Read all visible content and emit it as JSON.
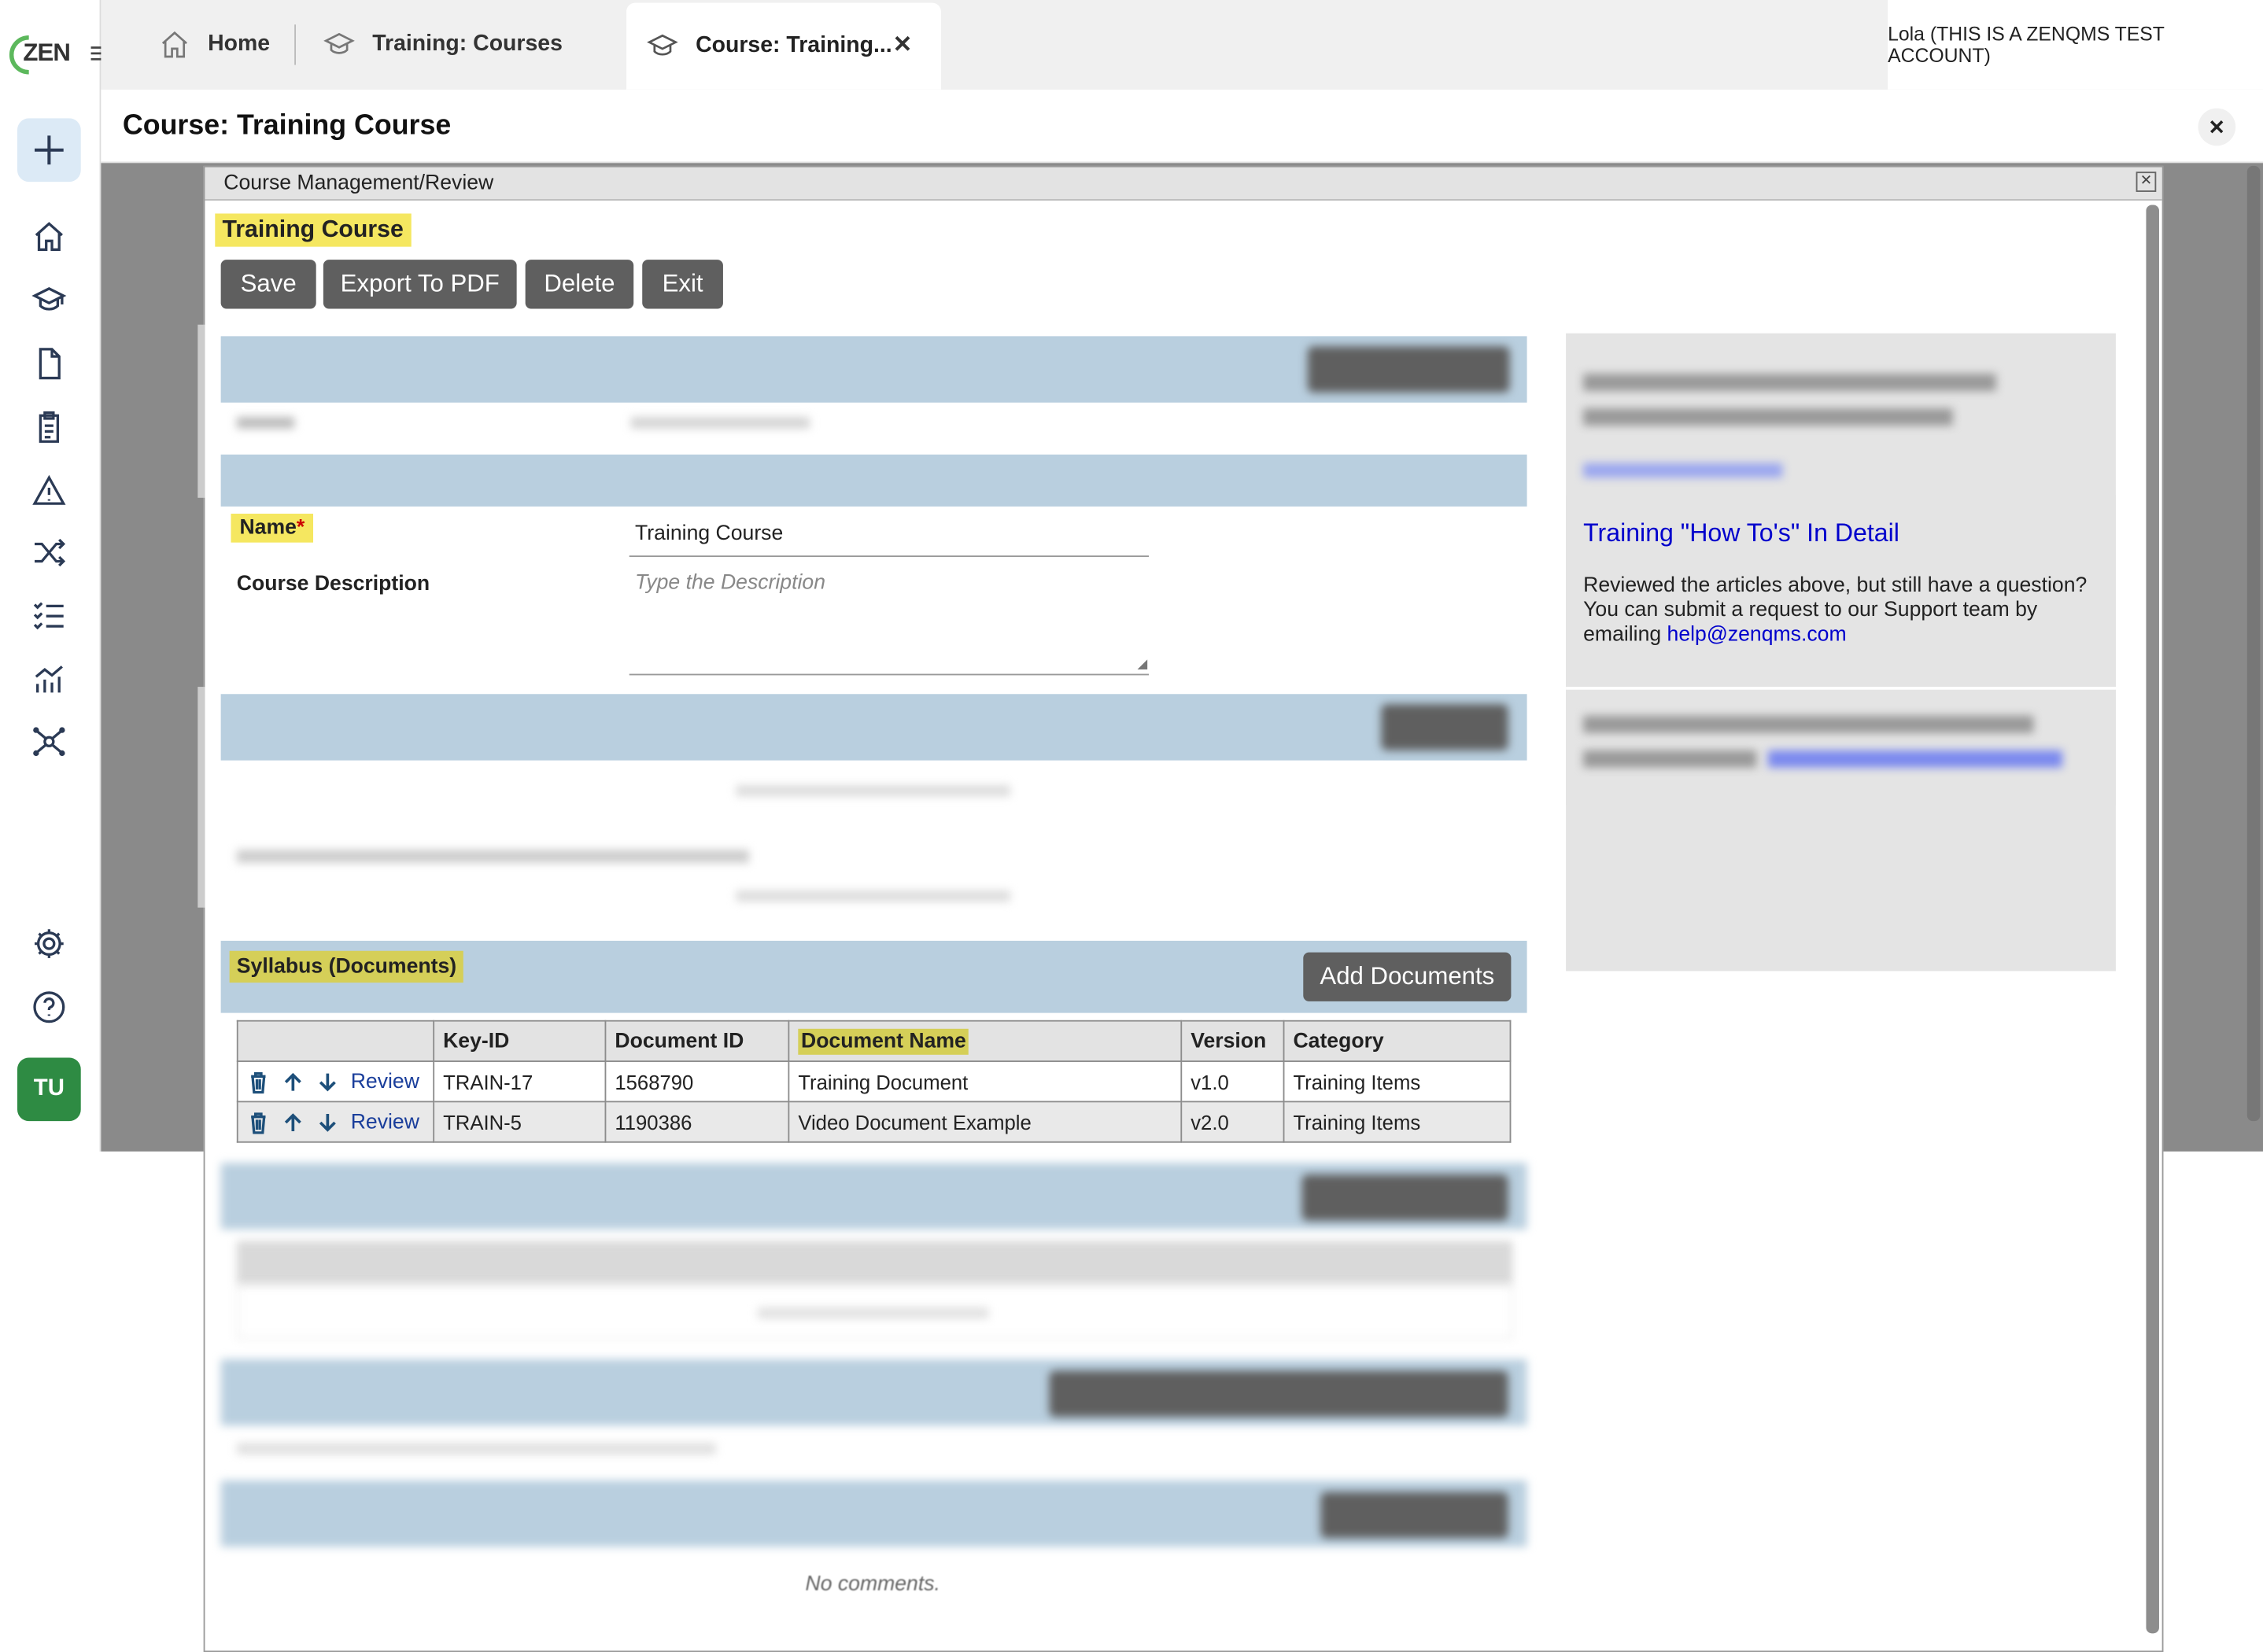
{
  "app": {
    "logo_text": "ZEN",
    "user_initials": "TU",
    "user_label": "Lola (THIS IS A ZENQMS TEST ACCOUNT)"
  },
  "tabs": [
    {
      "label": "Home",
      "icon": "home-icon"
    },
    {
      "label": "Training: Courses",
      "icon": "graduation-cap-icon"
    },
    {
      "label": "Course: Training...",
      "icon": "graduation-cap-icon",
      "active": true
    }
  ],
  "page": {
    "title": "Course: Training Course"
  },
  "sidebar": {
    "icons": [
      "plus-icon",
      "home-icon",
      "graduation-cap-icon",
      "document-icon",
      "clipboard-icon",
      "warning-icon",
      "shuffle-icon",
      "checklist-icon",
      "analytics-icon",
      "network-icon",
      "settings-icon",
      "help-icon"
    ]
  },
  "modal": {
    "window_title": "Course Management/Review",
    "heading": "Training Course",
    "buttons": {
      "save": "Save",
      "export": "Export To PDF",
      "delete": "Delete",
      "exit": "Exit"
    },
    "name_label": "Name",
    "required_mark": "*",
    "name_value": "Training Course",
    "desc_label": "Course Description",
    "desc_placeholder": "Type the Description",
    "syllabus": {
      "title": "Syllabus (Documents)",
      "add_button": "Add Documents",
      "columns": [
        "",
        "Key-ID",
        "Document ID",
        "Document Name",
        "Version",
        "Category"
      ],
      "review_label": "Review",
      "rows": [
        {
          "key_id": "TRAIN-17",
          "doc_id": "1568790",
          "name": "Training Document",
          "version": "v1.0",
          "category": "Training Items"
        },
        {
          "key_id": "TRAIN-5",
          "doc_id": "1190386",
          "name": "Video Document Example",
          "version": "v2.0",
          "category": "Training Items"
        }
      ]
    },
    "no_comments": "No comments."
  },
  "help_panel": {
    "howto_link": "Training \"How To's\" In Detail",
    "text": "Reviewed the articles above, but still have a question? You can submit a request to our Support team by emailing",
    "email": "help@zenqms.com"
  },
  "colors": {
    "section_bar": "#b9cfdf",
    "dark_button": "#5f5f5f",
    "highlight": "#f5e760",
    "user_badge": "#2e8b43",
    "link": "#0000cc"
  }
}
